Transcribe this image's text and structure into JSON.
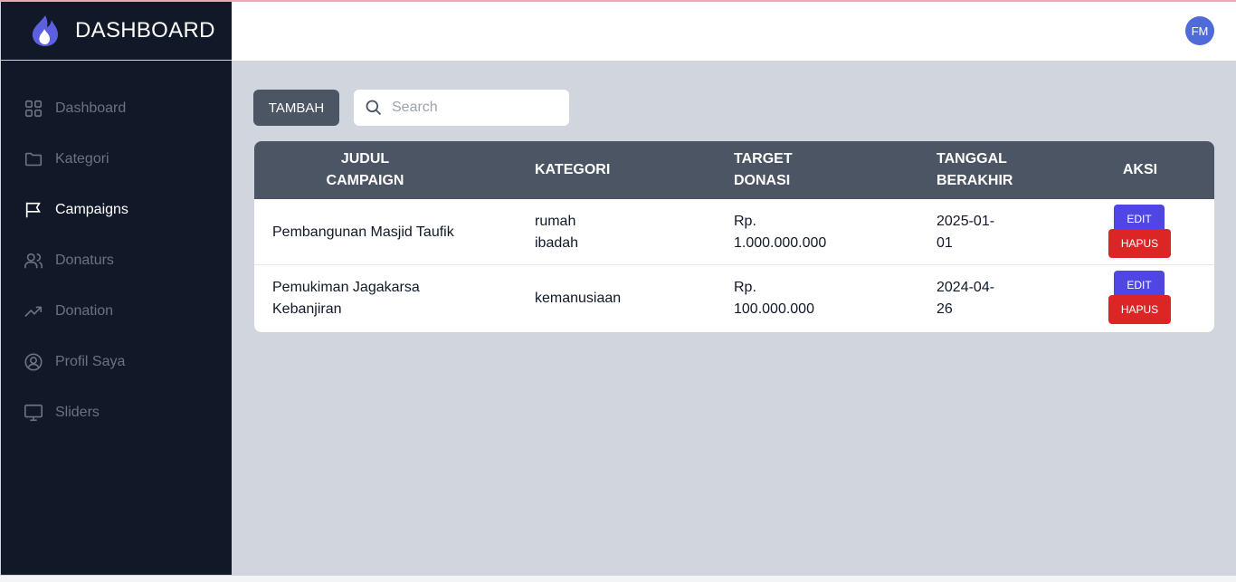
{
  "brand": {
    "title": "DASHBOARD",
    "icon": "flame-icon",
    "color": "#5b5fe0"
  },
  "sidebar": {
    "items": [
      {
        "label": "Dashboard",
        "icon": "grid-icon",
        "active": false
      },
      {
        "label": "Kategori",
        "icon": "folder-icon",
        "active": false
      },
      {
        "label": "Campaigns",
        "icon": "flag-icon",
        "active": true
      },
      {
        "label": "Donaturs",
        "icon": "users-icon",
        "active": false
      },
      {
        "label": "Donation",
        "icon": "trending-up-icon",
        "active": false
      },
      {
        "label": "Profil Saya",
        "icon": "user-circle-icon",
        "active": false
      },
      {
        "label": "Sliders",
        "icon": "desktop-icon",
        "active": false
      }
    ]
  },
  "header": {
    "avatar_initials": "FM"
  },
  "toolbar": {
    "add_label": "TAMBAH",
    "search_placeholder": "Search"
  },
  "table": {
    "headers": {
      "judul_line1": "JUDUL",
      "judul_line2": "CAMPAIGN",
      "kategori": "KATEGORI",
      "target_line1": "TARGET",
      "target_line2": "DONASI",
      "tanggal_line1": "TANGGAL",
      "tanggal_line2": "BERAKHIR",
      "aksi": "AKSI"
    },
    "rows": [
      {
        "judul_line1": "Pembangunan Masjid Taufik",
        "judul_line2": "",
        "kategori_line1": "rumah",
        "kategori_line2": "ibadah",
        "target_line1": "Rp.",
        "target_line2": "1.000.000.000",
        "tanggal_line1": "2025-01-",
        "tanggal_line2": "01",
        "edit_label": "EDIT",
        "delete_label": "HAPUS"
      },
      {
        "judul_line1": "Pemukiman Jagakarsa",
        "judul_line2": "Kebanjiran",
        "kategori_line1": "kemanusiaan",
        "kategori_line2": "",
        "target_line1": "Rp.",
        "target_line2": "100.000.000",
        "tanggal_line1": "2024-04-",
        "tanggal_line2": "26",
        "edit_label": "EDIT",
        "delete_label": "HAPUS"
      }
    ]
  },
  "colors": {
    "sidebar_bg": "#111827",
    "content_bg": "#d1d5de",
    "header_row": "#4b5563",
    "edit": "#4f46e5",
    "delete": "#dc2626"
  }
}
